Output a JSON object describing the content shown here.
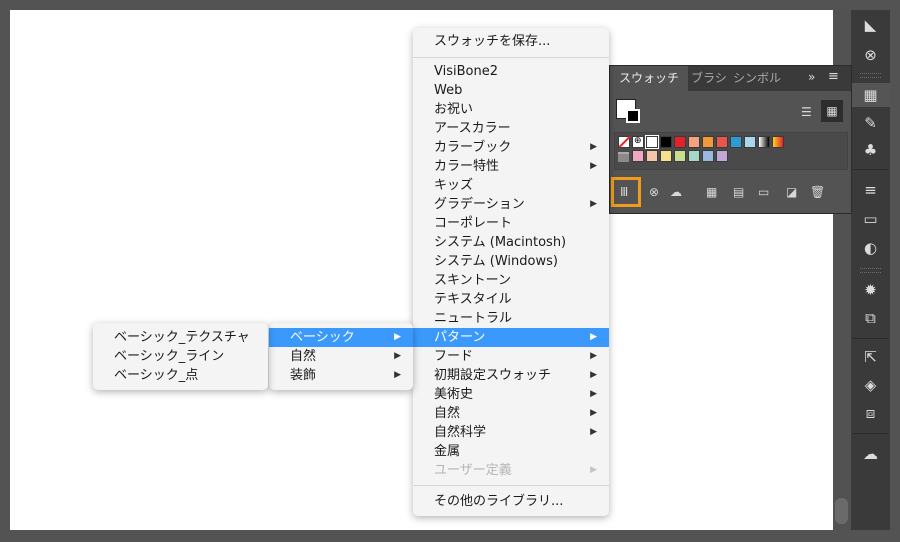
{
  "main_menu": {
    "save": "スウォッチを保存...",
    "items": [
      {
        "label": "VisiBone2",
        "arrow": false,
        "state": "normal"
      },
      {
        "label": "Web",
        "arrow": false,
        "state": "normal"
      },
      {
        "label": "お祝い",
        "arrow": false,
        "state": "normal"
      },
      {
        "label": "アースカラー",
        "arrow": false,
        "state": "normal"
      },
      {
        "label": "カラーブック",
        "arrow": true,
        "state": "normal"
      },
      {
        "label": "カラー特性",
        "arrow": true,
        "state": "normal"
      },
      {
        "label": "キッズ",
        "arrow": false,
        "state": "normal"
      },
      {
        "label": "グラデーション",
        "arrow": true,
        "state": "normal"
      },
      {
        "label": "コーポレート",
        "arrow": false,
        "state": "normal"
      },
      {
        "label": "システム (Macintosh)",
        "arrow": false,
        "state": "normal"
      },
      {
        "label": "システム (Windows)",
        "arrow": false,
        "state": "normal"
      },
      {
        "label": "スキントーン",
        "arrow": false,
        "state": "normal"
      },
      {
        "label": "テキスタイル",
        "arrow": false,
        "state": "normal"
      },
      {
        "label": "ニュートラル",
        "arrow": false,
        "state": "normal"
      },
      {
        "label": "パターン",
        "arrow": true,
        "state": "highlighted"
      },
      {
        "label": "フード",
        "arrow": true,
        "state": "normal"
      },
      {
        "label": "初期設定スウォッチ",
        "arrow": true,
        "state": "normal"
      },
      {
        "label": "美術史",
        "arrow": true,
        "state": "normal"
      },
      {
        "label": "自然",
        "arrow": true,
        "state": "normal"
      },
      {
        "label": "自然科学",
        "arrow": true,
        "state": "normal"
      },
      {
        "label": "金属",
        "arrow": false,
        "state": "normal"
      },
      {
        "label": "ユーザー定義",
        "arrow": true,
        "state": "disabled"
      }
    ],
    "other_libraries": "その他のライブラリ..."
  },
  "submenu_pattern": {
    "items": [
      {
        "label": "ベーシック",
        "arrow": true,
        "state": "highlighted"
      },
      {
        "label": "自然",
        "arrow": true,
        "state": "normal"
      },
      {
        "label": "装飾",
        "arrow": true,
        "state": "normal"
      }
    ]
  },
  "submenu_basic": {
    "items": [
      {
        "label": "ベーシック_テクスチャ"
      },
      {
        "label": "ベーシック_ライン"
      },
      {
        "label": "ベーシック_点"
      }
    ]
  },
  "swatch_panel": {
    "tabs": [
      "スウォッチ",
      "ブラシ",
      "シンボル"
    ],
    "active_tab": "スウォッチ",
    "row1_colors": [
      "#ffffff",
      "#000000",
      "#e8202a",
      "#f7a27e",
      "#f29a3b",
      "#e8554c",
      "#2e9ad6",
      "#a8d8ef"
    ],
    "row2_colors": [
      "#f3a6c3",
      "#f6c4a6",
      "#f4e28b",
      "#c8df8e",
      "#a6d6c4",
      "#9bb8e0",
      "#c2a6d6"
    ]
  },
  "accent_color": "#3b99fc",
  "highlight_box_color": "#f29a1c"
}
